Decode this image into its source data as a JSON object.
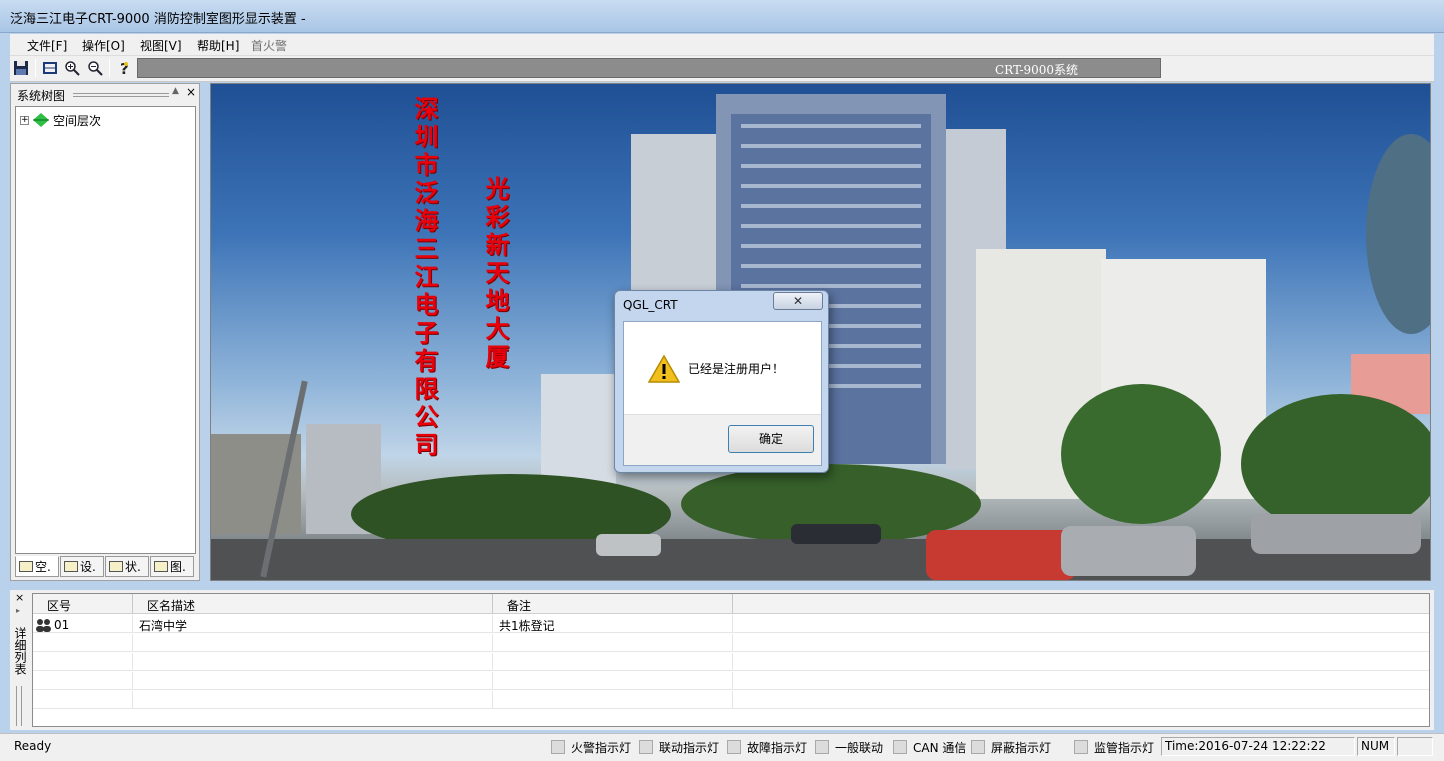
{
  "window": {
    "title": "泛海三江电子CRT-9000 消防控制室图形显示装置 -"
  },
  "menu": {
    "items": [
      {
        "label": "文件[F]"
      },
      {
        "label": "操作[O]"
      },
      {
        "label": "视图[V]"
      },
      {
        "label": "帮助[H]"
      },
      {
        "label": "首火警"
      }
    ]
  },
  "toolbar": {
    "icons": [
      "save-icon",
      "fit-window-icon",
      "zoom-in-icon",
      "zoom-out-icon",
      "help-icon"
    ],
    "system_label": "CRT-9000系统"
  },
  "left_panel": {
    "title": "系统树图",
    "tree": [
      {
        "label": "空间层次"
      }
    ],
    "tabs": [
      {
        "label": "空."
      },
      {
        "label": "设."
      },
      {
        "label": "状."
      },
      {
        "label": "图."
      }
    ]
  },
  "main_view": {
    "overlay_text_left": "深圳市泛海三江电子有限公司",
    "overlay_text_right": "光彩新天地大厦"
  },
  "dialog": {
    "title": "QGL_CRT",
    "message": "已经是注册用户！",
    "ok_label": "确定",
    "icon": "warning-icon"
  },
  "detail_list": {
    "side_label": "详细列表",
    "columns": [
      "区号",
      "区名描述",
      "备注"
    ],
    "rows": [
      {
        "zone": "01",
        "description": "石湾中学",
        "remark": "共1栋登记"
      }
    ]
  },
  "status": {
    "ready": "Ready",
    "indicators": [
      {
        "label": "火警指示灯"
      },
      {
        "label": "联动指示灯"
      },
      {
        "label": "故障指示灯"
      },
      {
        "label": "一般联动"
      },
      {
        "label": "CAN 通信"
      },
      {
        "label": "屏蔽指示灯"
      },
      {
        "label": "监管指示灯"
      }
    ],
    "time": "Time:2016-07-24    12:22:22",
    "num": "NUM"
  }
}
